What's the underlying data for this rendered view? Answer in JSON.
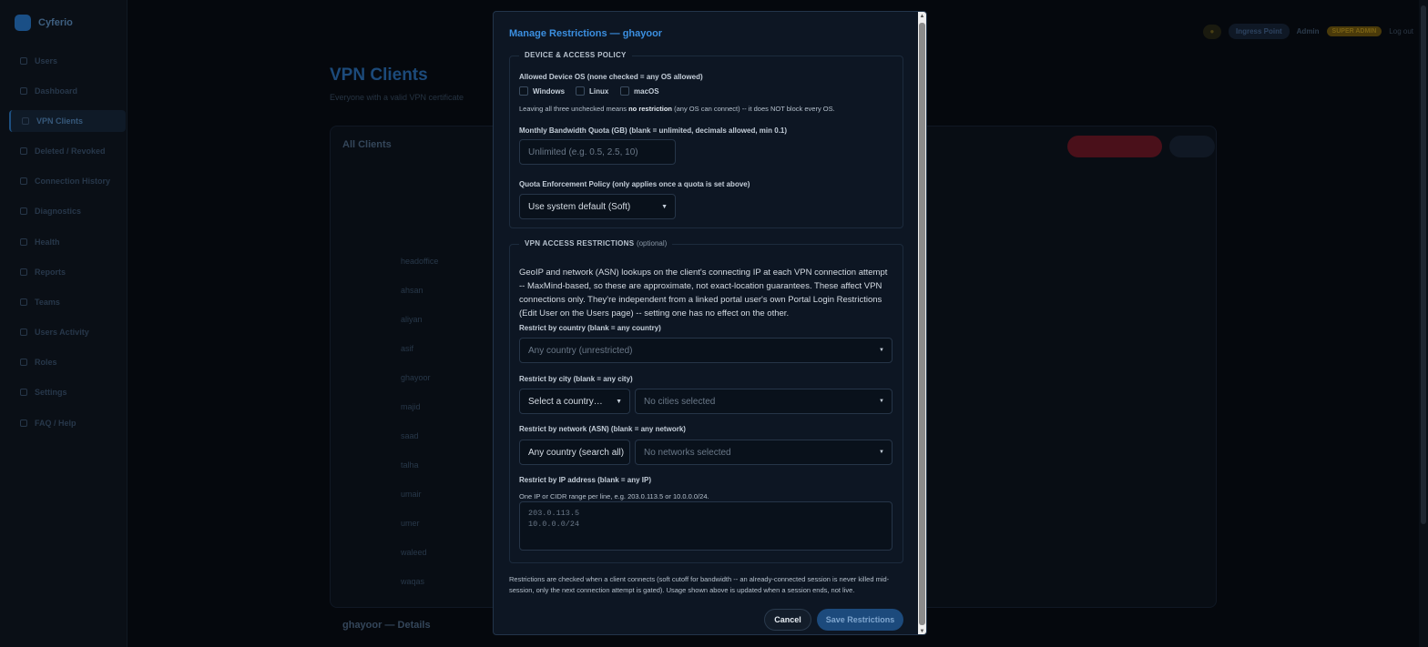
{
  "app": {
    "name": "Cyferio"
  },
  "sidebar": {
    "items": [
      {
        "label": "Users"
      },
      {
        "label": "Dashboard"
      },
      {
        "label": "VPN Clients"
      },
      {
        "label": "Deleted / Revoked"
      },
      {
        "label": "Connection History"
      },
      {
        "label": "Diagnostics"
      },
      {
        "label": "Health"
      },
      {
        "label": "Reports"
      },
      {
        "label": "Teams"
      },
      {
        "label": "Users Activity"
      },
      {
        "label": "Roles"
      },
      {
        "label": "Settings"
      },
      {
        "label": "FAQ / Help"
      }
    ]
  },
  "topbar": {
    "ingress": "Ingress Point",
    "admin": "Admin",
    "badge": "SUPER ADMIN",
    "logout": "Log out"
  },
  "page": {
    "title": "VPN Clients",
    "subtitle": "Everyone with a valid VPN certificate",
    "card_title": "All Clients",
    "details_title": "ghayoor — Details"
  },
  "clients": [
    "headoffice",
    "ahsan",
    "aliyan",
    "asif",
    "ghayoor",
    "majid",
    "saad",
    "talha",
    "umair",
    "umer",
    "waleed",
    "waqas"
  ],
  "modal": {
    "title": "Manage Restrictions — ghayoor",
    "device": {
      "legend": "DEVICE & ACCESS POLICY",
      "os_label": "Allowed Device OS (none checked = any OS allowed)",
      "os_options": [
        "Windows",
        "Linux",
        "macOS"
      ],
      "hint_pre": "Leaving all three unchecked means ",
      "hint_bold": "no restriction",
      "hint_post": " (any OS can connect) -- it does NOT block every OS.",
      "quota_label": "Monthly Bandwidth Quota (GB) (blank = unlimited, decimals allowed, min 0.1)",
      "quota_placeholder": "Unlimited (e.g. 0.5, 2.5, 10)",
      "policy_label": "Quota Enforcement Policy (only applies once a quota is set above)",
      "policy_value": "Use system default (Soft)"
    },
    "vpn": {
      "legend": "VPN ACCESS RESTRICTIONS",
      "legend_opt": "(optional)",
      "description": "GeoIP and network (ASN) lookups on the client's connecting IP at each VPN connection attempt -- MaxMind-based, so these are approximate, not exact-location guarantees. These affect VPN connections only. They're independent from a linked portal user's own Portal Login Restrictions (Edit User on the Users page) -- setting one has no effect on the other.",
      "country_label": "Restrict by country (blank = any country)",
      "country_value": "Any country (unrestricted)",
      "city_label": "Restrict by city (blank = any city)",
      "city_country_value": "Select a country…",
      "city_value": "No cities selected",
      "asn_label": "Restrict by network (ASN) (blank = any network)",
      "asn_country_value": "Any country (search all)",
      "asn_value": "No networks selected",
      "ip_label": "Restrict by IP address (blank = any IP)",
      "ip_hint": "One IP or CIDR range per line, e.g. 203.0.113.5 or 10.0.0.0/24.",
      "ip_placeholder": "203.0.113.5\n10.0.0.0/24"
    },
    "footer_note": "Restrictions are checked when a client connects (soft cutoff for bandwidth -- an already-connected session is never killed mid-session, only the next connection attempt is gated). Usage shown above is updated when a session ends, not live.",
    "cancel": "Cancel",
    "save": "Save Restrictions"
  }
}
